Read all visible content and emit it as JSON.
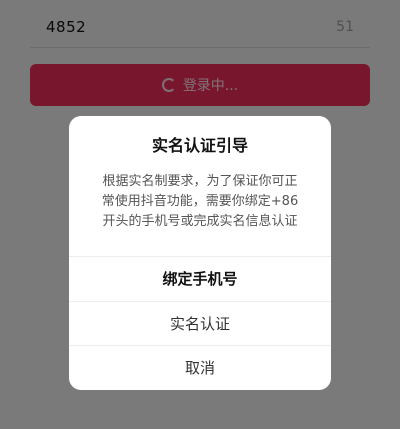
{
  "form": {
    "phone_value": "4852",
    "char_counter": "51",
    "login_button_label": "登录中..."
  },
  "dialog": {
    "title": "实名认证引导",
    "message": "根据实名制要求，为了保证你可正常使用抖音功能，需要你绑定+86开头的手机号或完成实名信息认证",
    "actions": [
      {
        "label": "绑定手机号"
      },
      {
        "label": "实名认证"
      },
      {
        "label": "取消"
      }
    ]
  },
  "colors": {
    "login_button": "#f12c5a",
    "overlay": "rgba(0,0,0,0.5)"
  }
}
